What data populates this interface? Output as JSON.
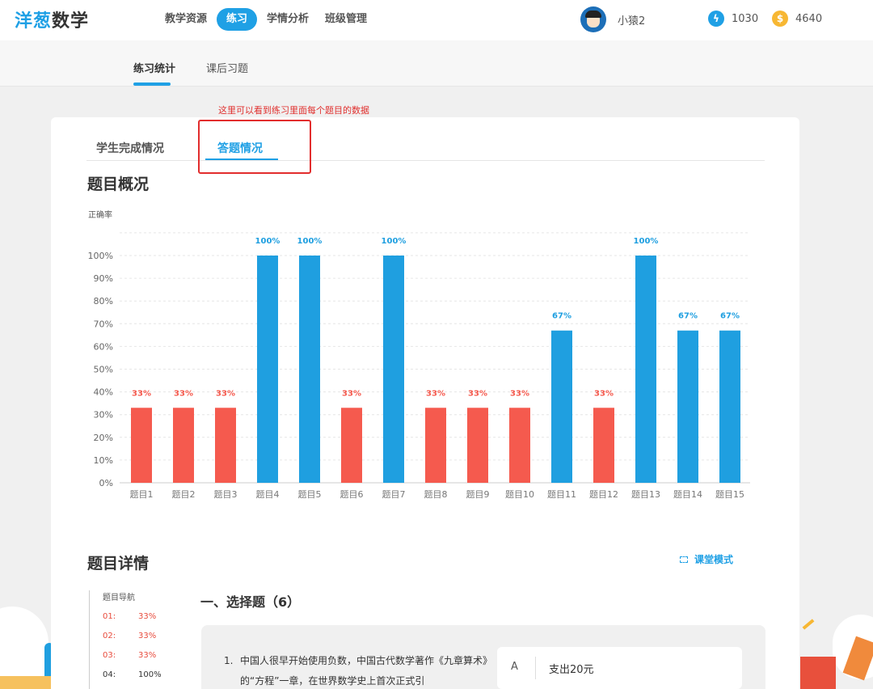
{
  "app": {
    "logo_part1": "洋葱",
    "logo_part2": "数学",
    "nav": [
      "教学资源",
      "练习",
      "学情分析",
      "班级管理"
    ],
    "active_nav": "练习",
    "user_name": "小猿2",
    "energy": "1030",
    "coins": "4640"
  },
  "subtabs": [
    "练习统计",
    "课后习题"
  ],
  "annotation": "这里可以看到练习里面每个题目的数据",
  "card": {
    "tabs": [
      "学生完成情况",
      "答题情况"
    ],
    "overview_title": "题目概况",
    "detail_title": "题目详情",
    "classroom_mode": "课堂模式"
  },
  "colors": {
    "accent": "#1fa0e5",
    "low": "#f55a4e",
    "high": "#1f9fe0",
    "annotation": "#e0302e"
  },
  "chart_data": {
    "type": "bar",
    "title": "",
    "ylabel": "正确率",
    "xlabel": "",
    "categories": [
      "题目1",
      "题目2",
      "题目3",
      "题目4",
      "题目5",
      "题目6",
      "题目7",
      "题目8",
      "题目9",
      "题目10",
      "题目11",
      "题目12",
      "题目13",
      "题目14",
      "题目15"
    ],
    "values": [
      33,
      33,
      33,
      100,
      100,
      33,
      100,
      33,
      33,
      33,
      67,
      33,
      100,
      67,
      67
    ],
    "value_labels": [
      "33%",
      "33%",
      "33%",
      "100%",
      "100%",
      "33%",
      "100%",
      "33%",
      "33%",
      "33%",
      "67%",
      "33%",
      "100%",
      "67%",
      "67%"
    ],
    "yticks": [
      "0%",
      "10%",
      "20%",
      "30%",
      "40%",
      "50%",
      "60%",
      "70%",
      "80%",
      "90%",
      "100%"
    ],
    "ylim": [
      0,
      100
    ],
    "grid": true,
    "legend": "none"
  },
  "question_nav": {
    "title": "题目导航",
    "items": [
      {
        "n": "01:",
        "v": "33%",
        "status": "red"
      },
      {
        "n": "02:",
        "v": "33%",
        "status": "red"
      },
      {
        "n": "03:",
        "v": "33%",
        "status": "red"
      },
      {
        "n": "04:",
        "v": "100%",
        "status": "dark"
      }
    ]
  },
  "section": {
    "title": "一、选择题（6）",
    "question": {
      "number": "1.",
      "text": "中国人很早开始使用负数，中国古代数学著作《九章算术》的“方程”一章，在世界数学史上首次正式引",
      "option_letter": "A",
      "option_text": "支出20元"
    }
  }
}
